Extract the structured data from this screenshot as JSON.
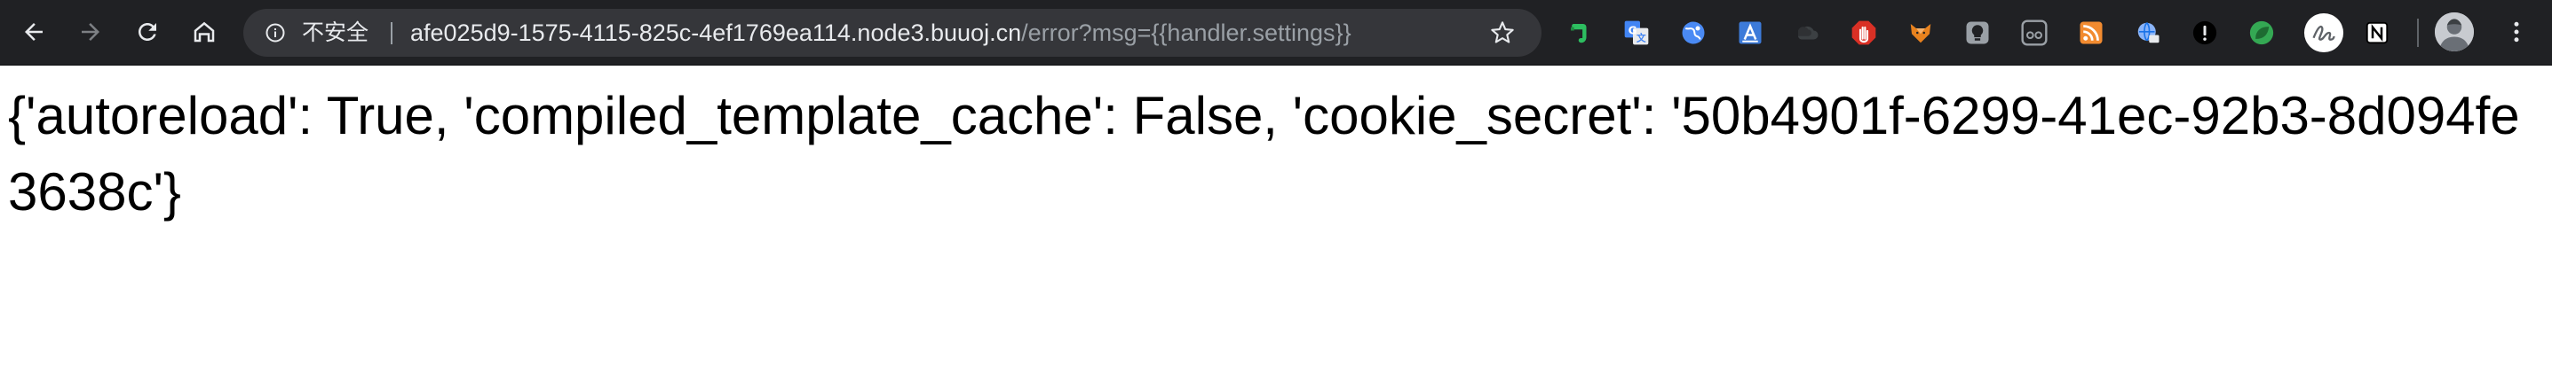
{
  "browser": {
    "toolbar": {
      "back_icon": "arrow-left-icon",
      "forward_icon": "arrow-right-icon",
      "reload_icon": "reload-icon",
      "home_icon": "home-icon"
    },
    "omnibox": {
      "security_icon": "info-icon",
      "security_label": "不安全",
      "url_host": "afe025d9-1575-4115-825c-4ef1769ea114.node3.buuoj.cn",
      "url_path": "/error?msg={{handler.settings}}",
      "bookmark_icon": "star-icon"
    },
    "extensions": [
      {
        "name": "evernote-icon",
        "color": "#2dbe60"
      },
      {
        "name": "google-translate-icon",
        "color": "#4285f4"
      },
      {
        "name": "globe-icon",
        "color": "#4a8af4"
      },
      {
        "name": "font-a-icon",
        "color": "#3d7bd9"
      },
      {
        "name": "cloud-icon",
        "color": "#3c4043"
      },
      {
        "name": "stop-hand-icon",
        "color": "#d93025"
      },
      {
        "name": "fox-icon",
        "color": "#e8821e"
      },
      {
        "name": "lightbulb-icon",
        "color": "#9aa0a6"
      },
      {
        "name": "glasses-icon",
        "color": "#9aa0a6"
      },
      {
        "name": "rss-icon",
        "color": "#f28b30"
      },
      {
        "name": "network-globe-icon",
        "color": "#8ab4f8"
      },
      {
        "name": "exclamation-icon",
        "color": "#000000"
      },
      {
        "name": "leaf-icon",
        "color": "#34a853"
      },
      {
        "name": "signature-icon",
        "color": "#ffffff"
      },
      {
        "name": "notion-icon",
        "color": "#ffffff"
      }
    ],
    "profile_icon": "avatar",
    "menu_icon": "more-vert-icon",
    "colors": {
      "toolbar_bg": "#202124",
      "omnibox_bg": "#35363a",
      "text_primary": "#e8eaed",
      "text_secondary": "#9aa0a6"
    }
  },
  "page": {
    "body_text": "{'autoreload': True, 'compiled_template_cache': False, 'cookie_secret': '50b4901f-6299-41ec-92b3-8d094fe3638c'}"
  }
}
